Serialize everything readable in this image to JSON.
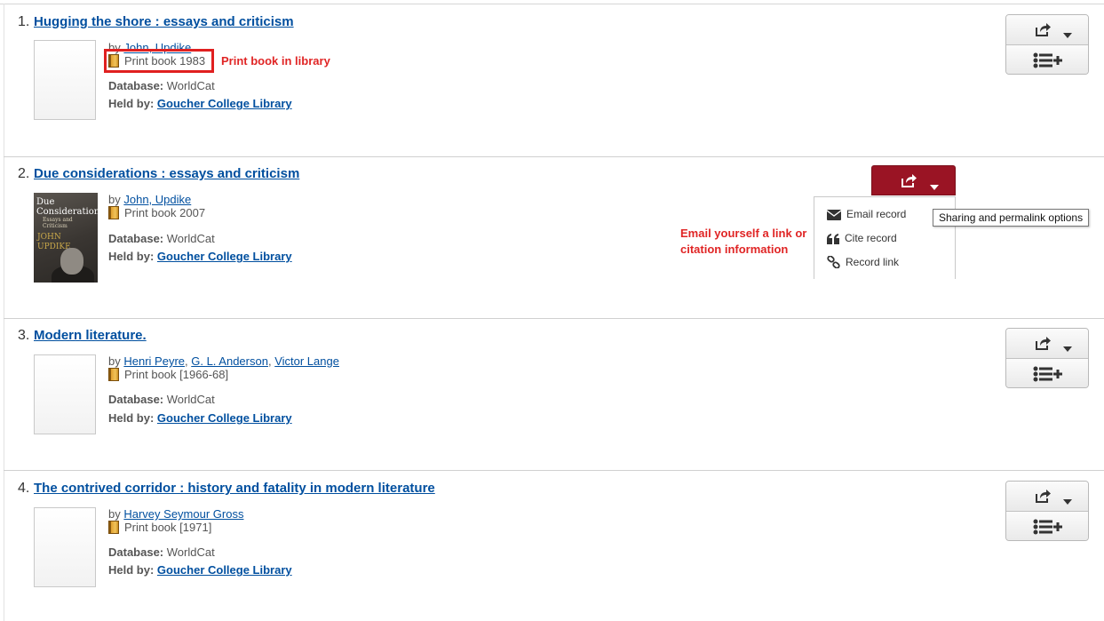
{
  "colors": {
    "link": "#004f9f",
    "annotation": "#e02525",
    "share_active": "#9a1424"
  },
  "records": [
    {
      "number": "1.",
      "title": "Hugging the shore : essays and criticism",
      "by": "by",
      "authors": [
        "John, Updike"
      ],
      "format": "Print book",
      "year": "1983",
      "database_label": "Database:",
      "database": "WorldCat",
      "held_label": "Held by:",
      "held_by": "Goucher College Library"
    },
    {
      "number": "2.",
      "title": "Due considerations : essays and criticism",
      "by": "by",
      "authors": [
        "John, Updike"
      ],
      "format": "Print book",
      "year": "2007",
      "database_label": "Database:",
      "database": "WorldCat",
      "held_label": "Held by:",
      "held_by": "Goucher College Library",
      "cover": {
        "title_line1": "Due",
        "title_line2": "Considerations",
        "subtitle": "Essays and Criticism",
        "author_line1": "JOHN",
        "author_line2": "UPDIKE"
      }
    },
    {
      "number": "3.",
      "title": "Modern literature.",
      "by": "by",
      "authors": [
        "Henri Peyre",
        "G. L. Anderson",
        "Victor Lange"
      ],
      "format": "Print book",
      "year": "[1966-68]",
      "database_label": "Database:",
      "database": "WorldCat",
      "held_label": "Held by:",
      "held_by": "Goucher College Library"
    },
    {
      "number": "4.",
      "title": "The contrived corridor : history and fatality in modern literature",
      "by": "by",
      "authors": [
        "Harvey Seymour Gross"
      ],
      "format": "Print book",
      "year": "[1971]",
      "database_label": "Database:",
      "database": "WorldCat",
      "held_label": "Held by:",
      "held_by": "Goucher College Library"
    }
  ],
  "share_menu": {
    "items": [
      {
        "label": "Email record",
        "icon": "envelope-icon"
      },
      {
        "label": "Cite record",
        "icon": "quote-icon"
      },
      {
        "label": "Record link",
        "icon": "link-icon"
      }
    ],
    "tooltip": "Sharing and permalink options"
  },
  "annotations": {
    "print_book": "Print book in library",
    "email_line1": "Email yourself a link or",
    "email_line2": "citation information"
  },
  "icons": {
    "share": "share-icon",
    "caret": "caret-down-icon",
    "add_to_list": "list-add-icon",
    "book": "book-icon"
  }
}
